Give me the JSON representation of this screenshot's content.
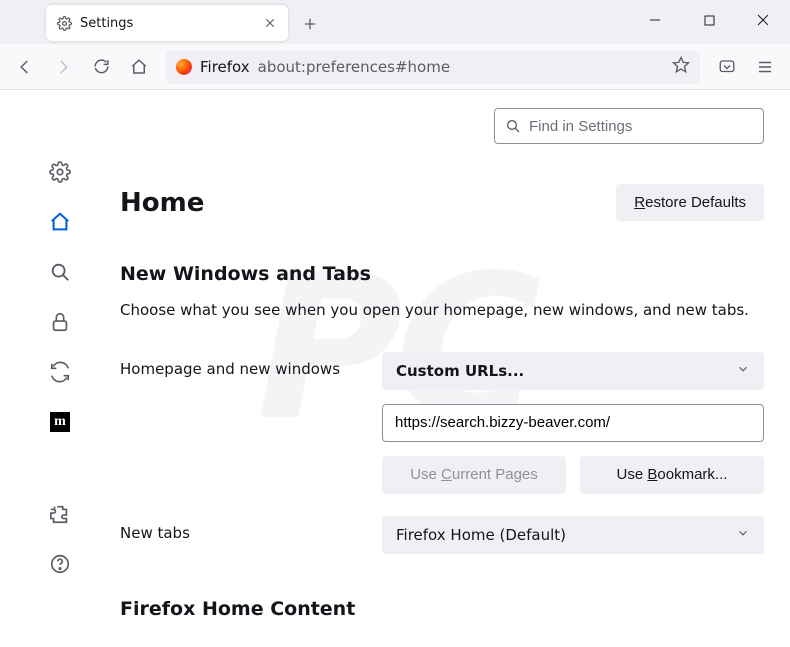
{
  "window": {
    "tab_title": "Settings"
  },
  "toolbar": {
    "address_label": "Firefox",
    "address_url": "about:preferences#home"
  },
  "search": {
    "placeholder": "Find in Settings"
  },
  "page": {
    "title": "Home",
    "restore_prefix": "R",
    "restore_suffix": "estore Defaults"
  },
  "section1": {
    "heading": "New Windows and Tabs",
    "description": "Choose what you see when you open your homepage, new windows, and new tabs."
  },
  "homepage": {
    "label": "Homepage and new windows",
    "select_value": "Custom URLs...",
    "url_value": "https://search.bizzy-beaver.com/",
    "use_current_prefix": "Use ",
    "use_current_ul": "C",
    "use_current_suffix": "urrent Pages",
    "use_bookmark_prefix": "Use ",
    "use_bookmark_ul": "B",
    "use_bookmark_suffix": "ookmark..."
  },
  "newtabs": {
    "label": "New tabs",
    "select_value": "Firefox Home (Default)"
  },
  "section2": {
    "heading": "Firefox Home Content"
  }
}
